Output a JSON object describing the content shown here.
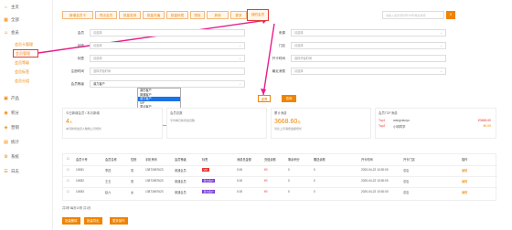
{
  "sidebar": {
    "items": [
      {
        "label": "主页",
        "icon": "home-icon"
      },
      {
        "label": "全部",
        "icon": "grid-icon"
      },
      {
        "label": "会员",
        "icon": "user-icon"
      },
      {
        "label": "产品",
        "icon": "box-icon"
      },
      {
        "label": "积分",
        "icon": "coin-icon"
      },
      {
        "label": "营销",
        "icon": "megaphone-icon"
      },
      {
        "label": "统计",
        "icon": "chart-icon"
      },
      {
        "label": "系统",
        "icon": "gear-icon"
      },
      {
        "label": "日志",
        "icon": "log-icon"
      }
    ],
    "subitems": [
      "会员卡管理",
      "会员管理",
      "会员等级",
      "会员标签",
      "会员分组"
    ]
  },
  "toolbar": {
    "buttons": [
      "新增会员卡",
      "导出会员",
      "批量发券",
      "批量充值",
      "批量标签",
      "短信",
      "其他",
      "更多"
    ],
    "highlight_button": "我的会员",
    "search_placeholder": "请输入会员手机号/卡号/姓名搜索"
  },
  "form": {
    "left_labels": [
      "会员",
      "状态",
      "标签",
      "注册时间",
      "会员等级"
    ],
    "right_labels": [
      "来源",
      "门店",
      "开卡时间",
      "最近消费"
    ],
    "select_placeholder": "请选择",
    "date_placeholder": "选择开始时间",
    "level_value": "潜力客户",
    "query_label": "查询",
    "reset_label": "重置"
  },
  "dropdown": {
    "options": [
      "潜在客户",
      "普通客户",
      "潜力客户",
      "VIP",
      "重点客户",
      "流失风险客户",
      "已流失客户",
      "忠实客户"
    ],
    "selected_index": 2
  },
  "stats": [
    {
      "title": "今日新增会员 / 本月新增",
      "value": "4",
      "unit": "人",
      "note": "本月新增会员人数较上月增长"
    },
    {
      "title": "会员总数",
      "value": "",
      "unit": "",
      "note": "平均每日新增会员数"
    },
    {
      "title": "累计消费",
      "value": "3668.60",
      "unit": "元",
      "note": "对比上月消费金额增长"
    },
    {
      "title": "会员TOP消费",
      "value": "",
      "unit": "",
      "note": ""
    }
  ],
  "top_list": [
    {
      "rank": "Top1",
      "name": "wangxiaoyu",
      "amount": "¥3668.60"
    },
    {
      "rank": "Top2",
      "name": "小明同学",
      "amount": "¥0.00"
    }
  ],
  "table": {
    "headers": [
      "会员卡号",
      "会员名称",
      "性别",
      "手机号码",
      "会员等级",
      "标签",
      "消费总金额",
      "充值余额",
      "剩余积分",
      "赠送余额",
      "开卡时间",
      "开卡门店",
      "操作"
    ],
    "rows": [
      [
        "10081",
        "李四",
        "男",
        "13872657623",
        "普通会员",
        "VIP",
        "0.00",
        "¥0",
        "0",
        "0",
        "2020-04-22 10:30:00",
        "总店",
        "编辑"
      ],
      [
        "10082",
        "王五",
        "男",
        "13872657623",
        "普通会员",
        "潜力客户",
        "0.00",
        "¥0",
        "0",
        "0",
        "2020-04-22 10:30:00",
        "总店",
        "编辑"
      ],
      [
        "10083",
        "赵六",
        "女",
        "13872657623",
        "普通会员",
        "潜力客户",
        "0.00",
        "¥0",
        "0",
        "0",
        "2020-04-22 10:30:00",
        "总店",
        "编辑"
      ]
    ]
  },
  "footer": {
    "summary": "共3条  每页10条  共1页",
    "buttons": [
      "批量删除",
      "批量导出",
      "更多操作"
    ]
  }
}
